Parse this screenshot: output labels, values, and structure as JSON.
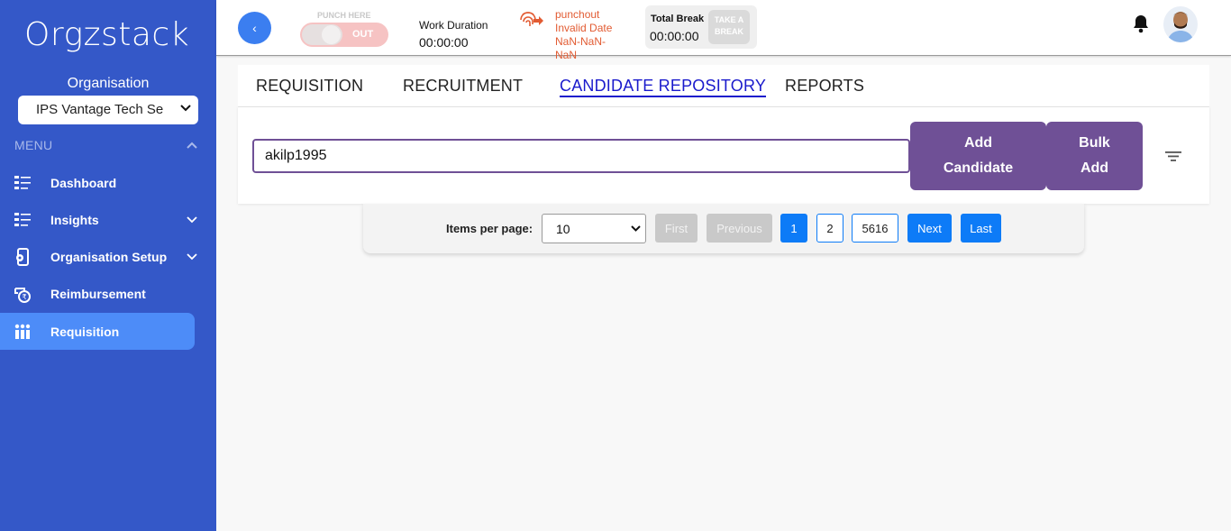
{
  "sidebar": {
    "logo": "Orgzstack",
    "org_label": "Organisation",
    "org_selected": "IPS Vantage Tech Se",
    "menu_label": "MENU",
    "items": [
      {
        "label": "Dashboard",
        "icon": "dashboard-icon",
        "active": false,
        "expandable": false
      },
      {
        "label": "Insights",
        "icon": "insights-icon",
        "active": false,
        "expandable": true
      },
      {
        "label": "Organisation Setup",
        "icon": "org-setup-icon",
        "active": false,
        "expandable": true
      },
      {
        "label": "Reimbursement",
        "icon": "reimbursement-icon",
        "active": false,
        "expandable": false
      },
      {
        "label": "Requisition",
        "icon": "requisition-icon",
        "active": true,
        "expandable": false
      }
    ]
  },
  "header": {
    "back_icon": "‹",
    "punch_label": "PUNCH HERE",
    "punch_state": "OUT",
    "work_duration_label": "Work Duration",
    "work_duration_value": "00:00:00",
    "punch_status_line1": "punchout",
    "punch_status_line2": "Invalid Date",
    "punch_status_line3": "NaN-NaN-NaN",
    "total_break_label": "Total Break",
    "total_break_value": "00:00:00",
    "take_break_label": "TAKE A BREAK"
  },
  "tabs": [
    {
      "label": "REQUISITION",
      "active": false
    },
    {
      "label": "RECRUITMENT",
      "active": false
    },
    {
      "label": "CANDIDATE REPOSITORY",
      "active": true
    },
    {
      "label": "REPORTS",
      "active": false
    }
  ],
  "search": {
    "value": "akilp1995",
    "add_candidate_label": "Add Candidate",
    "bulk_add_label": "Bulk Add"
  },
  "pagination": {
    "items_per_page_label": "Items per page:",
    "items_per_page_value": "10",
    "first_label": "First",
    "previous_label": "Previous",
    "pages": [
      "1",
      "2",
      "5616"
    ],
    "current_page": "1",
    "next_label": "Next",
    "last_label": "Last"
  },
  "colors": {
    "sidebar": "#3458c8",
    "active_nav": "#4d8cf8",
    "primary_purple": "#6f5096",
    "active_tab": "#1a1acc",
    "pagination_blue": "#0d7bf7",
    "punch_status": "#e25b32"
  }
}
